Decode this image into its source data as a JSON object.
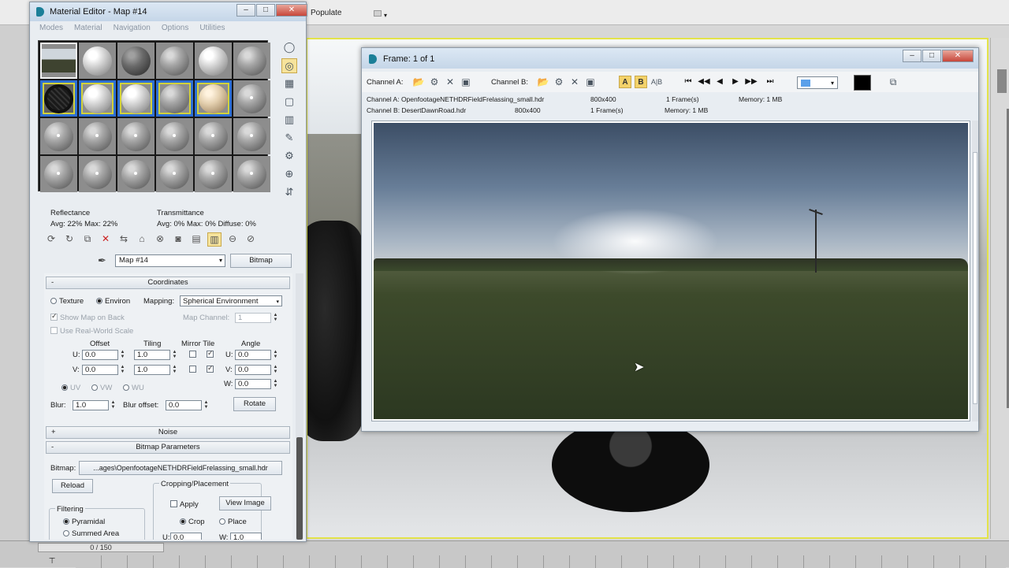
{
  "max": {
    "populate_label": "Populate",
    "timeline_value": "0 / 150"
  },
  "material_editor": {
    "title": "Material Editor - Map #14",
    "menu": [
      "Modes",
      "Material",
      "Navigation",
      "Options",
      "Utilities"
    ],
    "reflectance_label": "Reflectance",
    "reflectance_values": "Avg: 22% Max: 22%",
    "transmittance_label": "Transmittance",
    "transmittance_values": "Avg:   0% Max:   0%   Diffuse:   0%",
    "map_name": "Map #14",
    "map_type_button": "Bitmap",
    "coordinates": {
      "header": "Coordinates",
      "texture_label": "Texture",
      "environ_label": "Environ",
      "mapping_label": "Mapping:",
      "mapping_value": "Spherical Environment",
      "show_map_on_back": "Show Map on Back",
      "map_channel_label": "Map Channel:",
      "map_channel_value": "1",
      "use_real_world_scale": "Use Real-World Scale",
      "offset_label": "Offset",
      "tiling_label": "Tiling",
      "mirror_tile_label": "Mirror Tile",
      "angle_label": "Angle",
      "u_label": "U:",
      "v_label": "V:",
      "w_label": "W:",
      "u_offset": "0.0",
      "v_offset": "0.0",
      "u_tiling": "1.0",
      "v_tiling": "1.0",
      "u_angle": "0.0",
      "v_angle": "0.0",
      "w_angle": "0.0",
      "uv_label": "UV",
      "vw_label": "VW",
      "wu_label": "WU",
      "blur_label": "Blur:",
      "blur_value": "1.0",
      "blur_offset_label": "Blur offset:",
      "blur_offset_value": "0.0",
      "rotate_button": "Rotate"
    },
    "noise_header": "Noise",
    "bitmap_params": {
      "header": "Bitmap Parameters",
      "bitmap_label": "Bitmap:",
      "bitmap_path": "...ages\\OpenfootageNETHDRFieldFrelassing_small.hdr",
      "reload_button": "Reload",
      "cropping_label": "Cropping/Placement",
      "apply_label": "Apply",
      "view_image_button": "View Image",
      "crop_label": "Crop",
      "place_label": "Place",
      "filtering_label": "Filtering",
      "pyramidal_label": "Pyramidal",
      "summed_area_label": "Summed Area",
      "u_crop_value": "0.0",
      "w_crop_value": "1.0"
    }
  },
  "frame_window": {
    "title": "Frame: 1 of 1",
    "channel_a_label": "Channel A:",
    "channel_b_label": "Channel B:",
    "a_button": "A",
    "b_button": "B",
    "ab_button": "A|B",
    "info_a": {
      "name": "Channel A: OpenfootageNETHDRFieldFrelassing_small.hdr",
      "size": "800x400",
      "frames": "1 Frame(s)",
      "memory": "Memory: 1 MB"
    },
    "info_b": {
      "name": "Channel B: DesertDawnRoad.hdr",
      "size": "800x400",
      "frames": "1 Frame(s)",
      "memory": "Memory: 1 MB"
    }
  }
}
